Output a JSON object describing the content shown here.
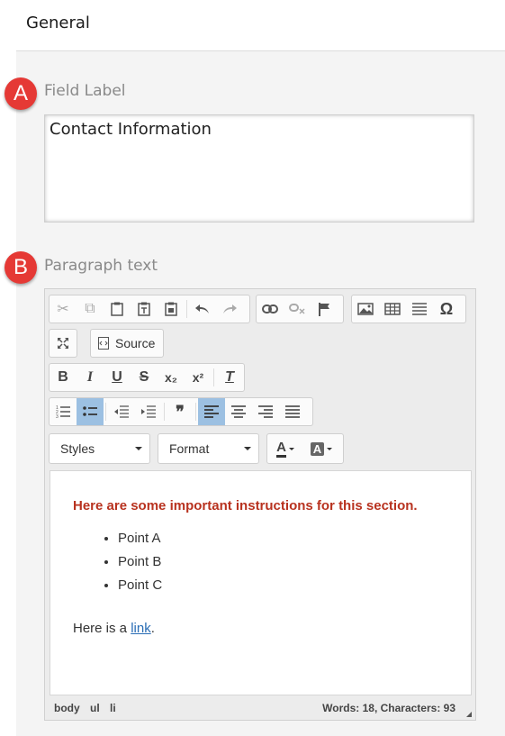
{
  "header": {
    "title": "General"
  },
  "badges": {
    "a": "A",
    "b": "B"
  },
  "field_label": {
    "label": "Field Label",
    "value": "Contact Information"
  },
  "paragraph": {
    "label": "Paragraph text"
  },
  "toolbar": {
    "source_label": "Source",
    "styles_label": "Styles",
    "format_label": "Format",
    "bold": "B",
    "italic": "I",
    "underline": "U",
    "strike": "S",
    "subscript": "x₂",
    "superscript": "x²",
    "remove_format": "T",
    "blockquote": "❞",
    "omega": "Ω",
    "text_color": "A",
    "bg_color": "A"
  },
  "editor_content": {
    "heading": "Here are some important instructions for this section.",
    "items": [
      "Point A",
      "Point B",
      "Point C"
    ],
    "para_prefix": "Here is a ",
    "link": "link",
    "para_suffix": "."
  },
  "statusbar": {
    "path": [
      "body",
      "ul",
      "li"
    ],
    "count": "Words: 18, Characters: 93"
  },
  "colors": {
    "badge": "#e53935",
    "heading": "#b8321f",
    "link": "#2a6db5",
    "active": "#9cc0e2"
  }
}
